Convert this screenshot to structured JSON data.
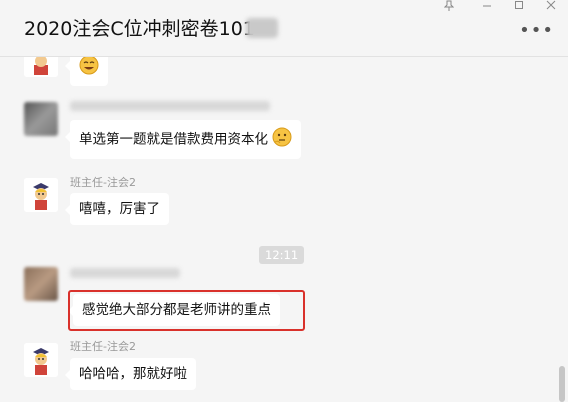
{
  "window": {
    "title": "2020注会C位冲刺密卷101",
    "pin_icon": "pin-icon",
    "minimize_icon": "minimize-icon",
    "maximize_icon": "maximize-icon",
    "close_icon": "close-icon",
    "more_icon": "more-icon"
  },
  "messages": [
    {
      "sender": "",
      "text": "",
      "emoji": "laughing-face-emoji"
    },
    {
      "sender": "",
      "text": "单选第一题就是借款费用资本化",
      "emoji": "thinking-face-emoji"
    },
    {
      "sender": "班主任-注会2",
      "text": "嘻嘻，厉害了"
    },
    {
      "timestamp": "12:11"
    },
    {
      "sender": "",
      "text": "感觉绝大部分都是老师讲的重点",
      "highlighted": true
    },
    {
      "sender": "班主任-注会2",
      "text": "哈哈哈，那就好啦"
    }
  ],
  "colors": {
    "highlight": "#d9312b",
    "bubble": "#ffffff",
    "background": "#f5f5f5"
  }
}
